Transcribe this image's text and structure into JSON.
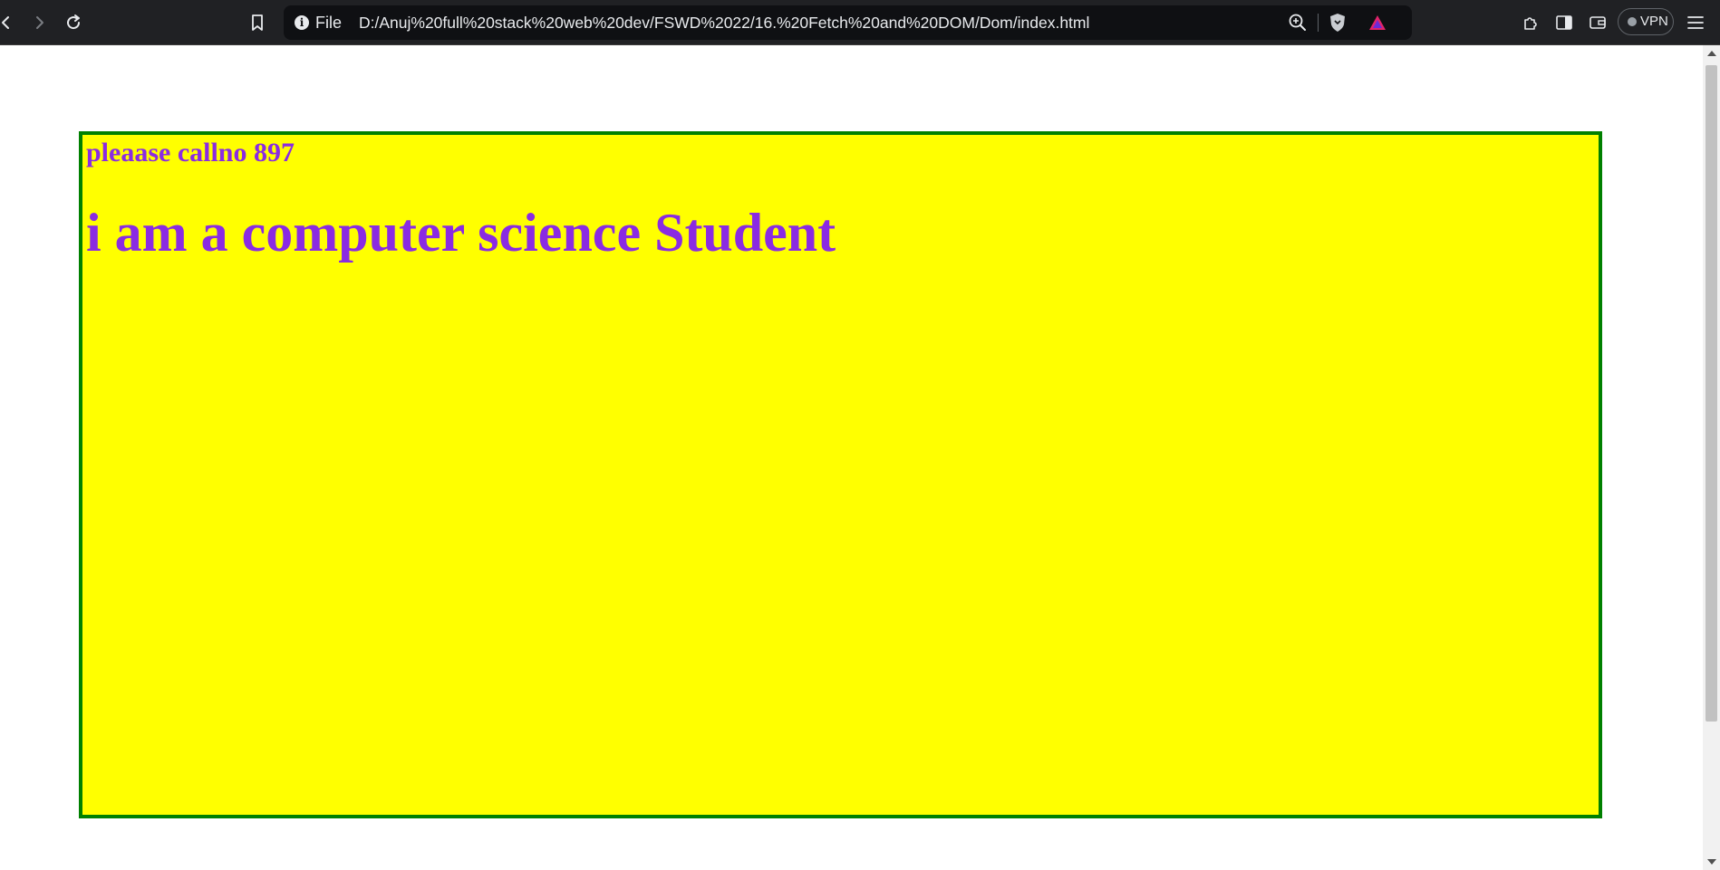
{
  "browser": {
    "address_bar": {
      "scheme_label": "File",
      "url": "D:/Anuj%20full%20stack%20web%20dev/FSWD%2022/16.%20Fetch%20and%20DOM/Dom/index.html"
    },
    "vpn_label": "VPN",
    "icons": [
      "back-icon",
      "forward-icon",
      "reload-icon",
      "bookmark-icon",
      "info-icon",
      "zoom-icon",
      "brave-shields-icon",
      "brave-rewards-icon",
      "extensions-icon",
      "sidebar-icon",
      "wallet-icon",
      "menu-icon"
    ]
  },
  "page": {
    "call_text": "pleaase callno 897",
    "student_text": "i am a computer science Student"
  },
  "colors": {
    "box_background": "#ffff00",
    "box_border": "#008000",
    "text": "#8a2be2",
    "toolbar": "#202124"
  }
}
